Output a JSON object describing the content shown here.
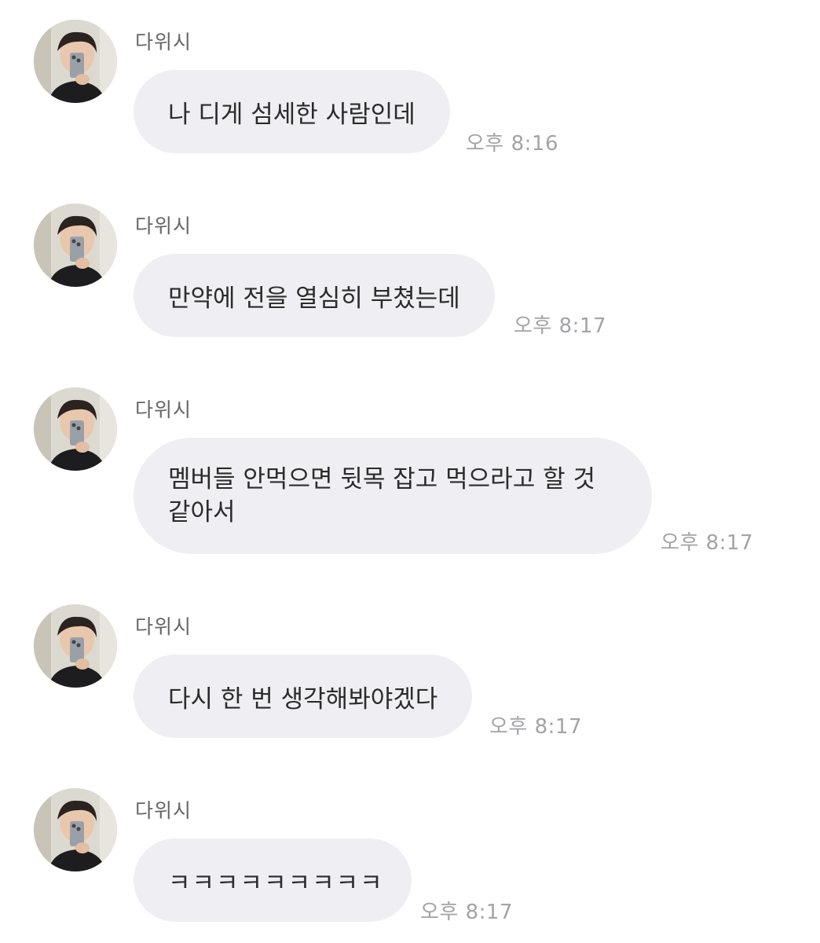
{
  "messages": [
    {
      "sender": "다위시",
      "text": "나 디게 섬세한 사람인데",
      "time": "오후 8:16"
    },
    {
      "sender": "다위시",
      "text": "만약에 전을 열심히 부쳤는데",
      "time": "오후 8:17"
    },
    {
      "sender": "다위시",
      "text": "멤버들 안먹으면 뒷목 잡고 먹으라고 할 것 같아서",
      "time": "오후 8:17"
    },
    {
      "sender": "다위시",
      "text": "다시 한 번 생각해봐야겠다",
      "time": "오후 8:17"
    },
    {
      "sender": "다위시",
      "text": "ㅋㅋㅋㅋㅋㅋㅋㅋㅋ",
      "time": "오후 8:17"
    }
  ]
}
